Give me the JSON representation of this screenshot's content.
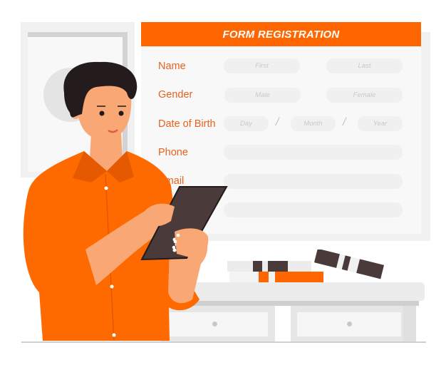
{
  "form": {
    "title": "FORM REGISTRATION",
    "fields": {
      "name": {
        "label": "Name",
        "first_placeholder": "First",
        "last_placeholder": "Last"
      },
      "gender": {
        "label": "Gender",
        "male_option": "Male",
        "female_option": "Female"
      },
      "dob": {
        "label": "Date of Birth",
        "day_placeholder": "Day",
        "month_placeholder": "Month",
        "year_placeholder": "Year",
        "separator": "/"
      },
      "phone": {
        "label": "Phone",
        "value": ""
      },
      "email": {
        "label": "Email",
        "value": ""
      },
      "extra": {
        "value": ""
      }
    }
  },
  "colors": {
    "accent": "#ff6600",
    "label": "#e8621c",
    "field_bg": "#f0f0f0",
    "panel_bg": "#f8f8f8",
    "skin": "#f9a875",
    "hair": "#241b1c",
    "tablet": "#4a3a39"
  }
}
